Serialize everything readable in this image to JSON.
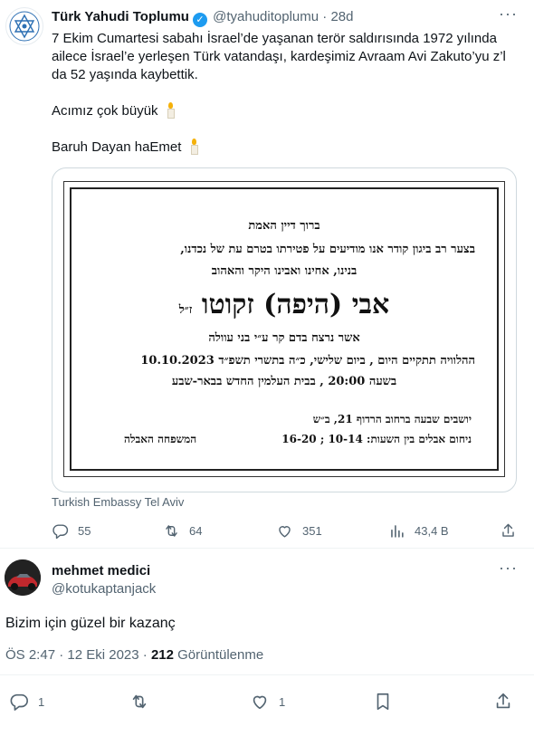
{
  "tweet": {
    "author_name": "Türk Yahudi Toplumu",
    "handle": "@tyahuditoplumu",
    "time": "28d",
    "text_line1": "7 Ekim Cumartesi sabahı İsrael’de yaşanan terör saldırısında 1972 yılında",
    "text_line2": "ailece İsrael’e yerleşen Türk vatandaşı, kardeşimiz Avraam Avi Zakuto’yu z’l",
    "text_line3": "da 52 yaşında kaybettik.",
    "text_line4": "Acımız çok büyük",
    "text_line5": "Baruh Dayan haEmet",
    "image_caption": "Turkish Embassy Tel Aviv",
    "notice": {
      "line1": "ברוך דיין האמת",
      "line2": "בצער רב ביגון קודר אנו מודיעים על פטירתו בטרם עת של נכדנו,",
      "line3": "בנינו, אחינו ואבינו היקר והאהוב",
      "line4": "אבי (היפה) זקוטו",
      "line4_suffix": "ז״ל",
      "line5": "אשר נרצח בדם קר ע״י בני עוולה",
      "line6": "ההלוויה תתקיים היום , ביום שלישי, כ״ה בתשרי תשפ״ד 10.10.2023",
      "line7": "בשעה 20:00 , בבית העלמין החדש בבאר-שבע",
      "line8": "יושבים שבעה ברחוב הרדוף 21, ב״ש",
      "line9": "ניחום אבלים בין השעות: 10-14 ; 16-20",
      "line10": "המשפחה האבלה"
    },
    "stats": {
      "replies": "55",
      "retweets": "64",
      "likes": "351",
      "views": "43,4 B"
    }
  },
  "reply": {
    "author_name": "mehmet medici",
    "handle": "@kotukaptanjack",
    "text": "Bizim için güzel bir kazanç",
    "time": "ÖS 2:47 · 12 Eki 2023 ·",
    "views_count": "212",
    "views_label": "Görüntülenme",
    "stats": {
      "replies": "1",
      "likes": "1"
    }
  }
}
